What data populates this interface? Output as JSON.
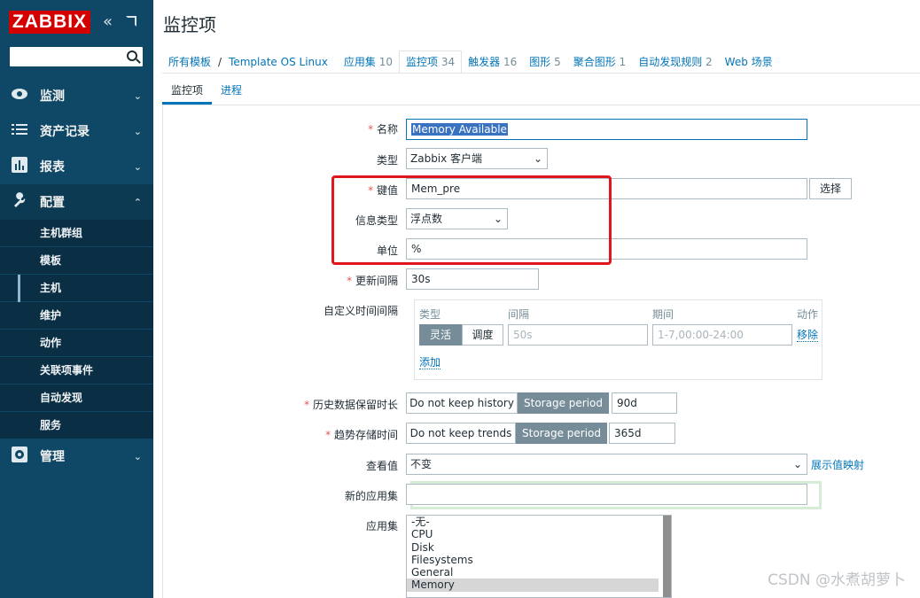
{
  "sidebar": {
    "logo": "ZABBIX",
    "sections": [
      {
        "label": "监测",
        "icon": "eye-icon"
      },
      {
        "label": "资产记录",
        "icon": "list-icon"
      },
      {
        "label": "报表",
        "icon": "bar-chart-icon"
      },
      {
        "label": "配置",
        "icon": "wrench-icon"
      },
      {
        "label": "管理",
        "icon": "gear-icon"
      }
    ],
    "config_items": [
      "主机群组",
      "模板",
      "主机",
      "维护",
      "动作",
      "关联项事件",
      "自动发现",
      "服务"
    ],
    "current_item": "主机"
  },
  "page": {
    "title": "监控项"
  },
  "breadcrumb": {
    "all_templates": "所有模板",
    "separator": "/",
    "template": "Template OS Linux",
    "links": [
      {
        "label": "应用集",
        "count": "10"
      },
      {
        "label": "监控项",
        "count": "34"
      },
      {
        "label": "触发器",
        "count": "16"
      },
      {
        "label": "图形",
        "count": "5"
      },
      {
        "label": "聚合图形",
        "count": "1"
      },
      {
        "label": "自动发现规则",
        "count": "2"
      },
      {
        "label": "Web 场景",
        "count": ""
      }
    ]
  },
  "tabs": [
    {
      "label": "监控项",
      "active": true
    },
    {
      "label": "进程",
      "active": false
    }
  ],
  "form": {
    "name": {
      "label": "名称",
      "value": "Memory Available"
    },
    "type": {
      "label": "类型",
      "value": "Zabbix 客户端"
    },
    "key": {
      "label": "键值",
      "value": "Mem_pre",
      "button": "选择"
    },
    "info_type": {
      "label": "信息类型",
      "value": "浮点数"
    },
    "units": {
      "label": "单位",
      "value": "%"
    },
    "update_interval": {
      "label": "更新间隔",
      "value": "30s"
    },
    "custom_intervals": {
      "label": "自定义时间间隔",
      "headers": {
        "type": "类型",
        "interval": "间隔",
        "period": "期间",
        "action": "动作"
      },
      "type_options": [
        "灵活",
        "调度"
      ],
      "interval_placeholder": "50s",
      "period_placeholder": "1-7,00:00-24:00",
      "remove": "移除",
      "add": "添加"
    },
    "history": {
      "label": "历史数据保留时长",
      "opt1": "Do not keep history",
      "opt2": "Storage period",
      "value": "90d"
    },
    "trends": {
      "label": "趋势存储时间",
      "opt1": "Do not keep trends",
      "opt2": "Storage period",
      "value": "365d"
    },
    "show_value": {
      "label": "查看值",
      "value": "不变",
      "link": "展示值映射"
    },
    "new_application": {
      "label": "新的应用集",
      "value": ""
    },
    "applications": {
      "label": "应用集",
      "options": [
        "-无-",
        "CPU",
        "Disk",
        "Filesystems",
        "General",
        "Memory"
      ],
      "selected": "Memory"
    }
  },
  "watermark": "CSDN @水煮胡萝卜",
  "colors": {
    "sidebar": "#0e4866",
    "logo": "#d40000",
    "link": "#0275b8",
    "highlight": "#e0161e"
  }
}
